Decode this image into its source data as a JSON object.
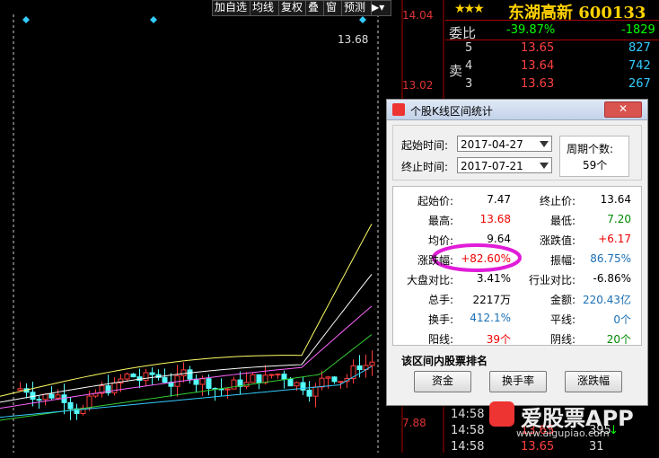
{
  "toolbar": [
    "加自选",
    "均线",
    "复权",
    "叠",
    "窗",
    "预测"
  ],
  "chart": {
    "price_labels": [
      "14.04",
      "13.02",
      "7.88"
    ],
    "max_marker": "13.68"
  },
  "quote": {
    "stars": "★★★",
    "name": "东湖高新 600133",
    "ratio_label": "委比",
    "ratio_value": "-39.87%",
    "ratio_diff": "-1829",
    "sell_label": "卖",
    "sell_rows": [
      {
        "level": "5",
        "price": "13.65",
        "vol": "827"
      },
      {
        "level": "4",
        "price": "13.64",
        "vol": "742"
      },
      {
        "level": "3",
        "price": "13.63",
        "vol": "267"
      }
    ],
    "ticks": [
      {
        "time": "14:58",
        "price": "",
        "vol": "",
        "arrow": ""
      },
      {
        "time": "14:58",
        "price": "13.65",
        "vol": "395",
        "arrow": "↓"
      },
      {
        "time": "14:58",
        "price": "13.65",
        "vol": "31",
        "arrow": ""
      }
    ]
  },
  "dialog": {
    "title": "个股K线区间统计",
    "close": "✕",
    "start_label": "起始时间:",
    "start_date": "2017-04-27",
    "end_label": "终止时间:",
    "end_date": "2017-07-21",
    "period_label": "周期个数:",
    "period_value": "59个",
    "stats_left": [
      {
        "k": "起始价:",
        "v": "7.47",
        "c": "#000"
      },
      {
        "k": "最高:",
        "v": "13.68",
        "c": "#e00"
      },
      {
        "k": "均价:",
        "v": "9.64",
        "c": "#000"
      },
      {
        "k": "涨跌幅:",
        "v": "+82.60%",
        "c": "#e00"
      },
      {
        "k": "大盘对比:",
        "v": "3.41%",
        "c": "#000"
      },
      {
        "k": "总手:",
        "v": "2217万",
        "c": "#000"
      },
      {
        "k": "换手:",
        "v": "412.1%",
        "c": "#1a6fb5"
      },
      {
        "k": "阳线:",
        "v": "39个",
        "c": "#e00"
      }
    ],
    "stats_right": [
      {
        "k": "终止价:",
        "v": "13.64",
        "c": "#000"
      },
      {
        "k": "最低:",
        "v": "7.20",
        "c": "#080"
      },
      {
        "k": "涨跌值:",
        "v": "+6.17",
        "c": "#e00"
      },
      {
        "k": "振幅:",
        "v": "86.75%",
        "c": "#1a6fb5"
      },
      {
        "k": "行业对比:",
        "v": "-6.86%",
        "c": "#000"
      },
      {
        "k": "金额:",
        "v": "220.43亿",
        "c": "#1a6fb5"
      },
      {
        "k": "平线:",
        "v": "0个",
        "c": "#1a6fb5"
      },
      {
        "k": "阴线:",
        "v": "20个",
        "c": "#080"
      }
    ],
    "rank_title": "该区间内股票排名",
    "buttons": [
      "资金",
      "换手率",
      "涨跌幅"
    ]
  },
  "watermark": {
    "text": "爱股票APP",
    "url": "www.aigupiao.com"
  }
}
